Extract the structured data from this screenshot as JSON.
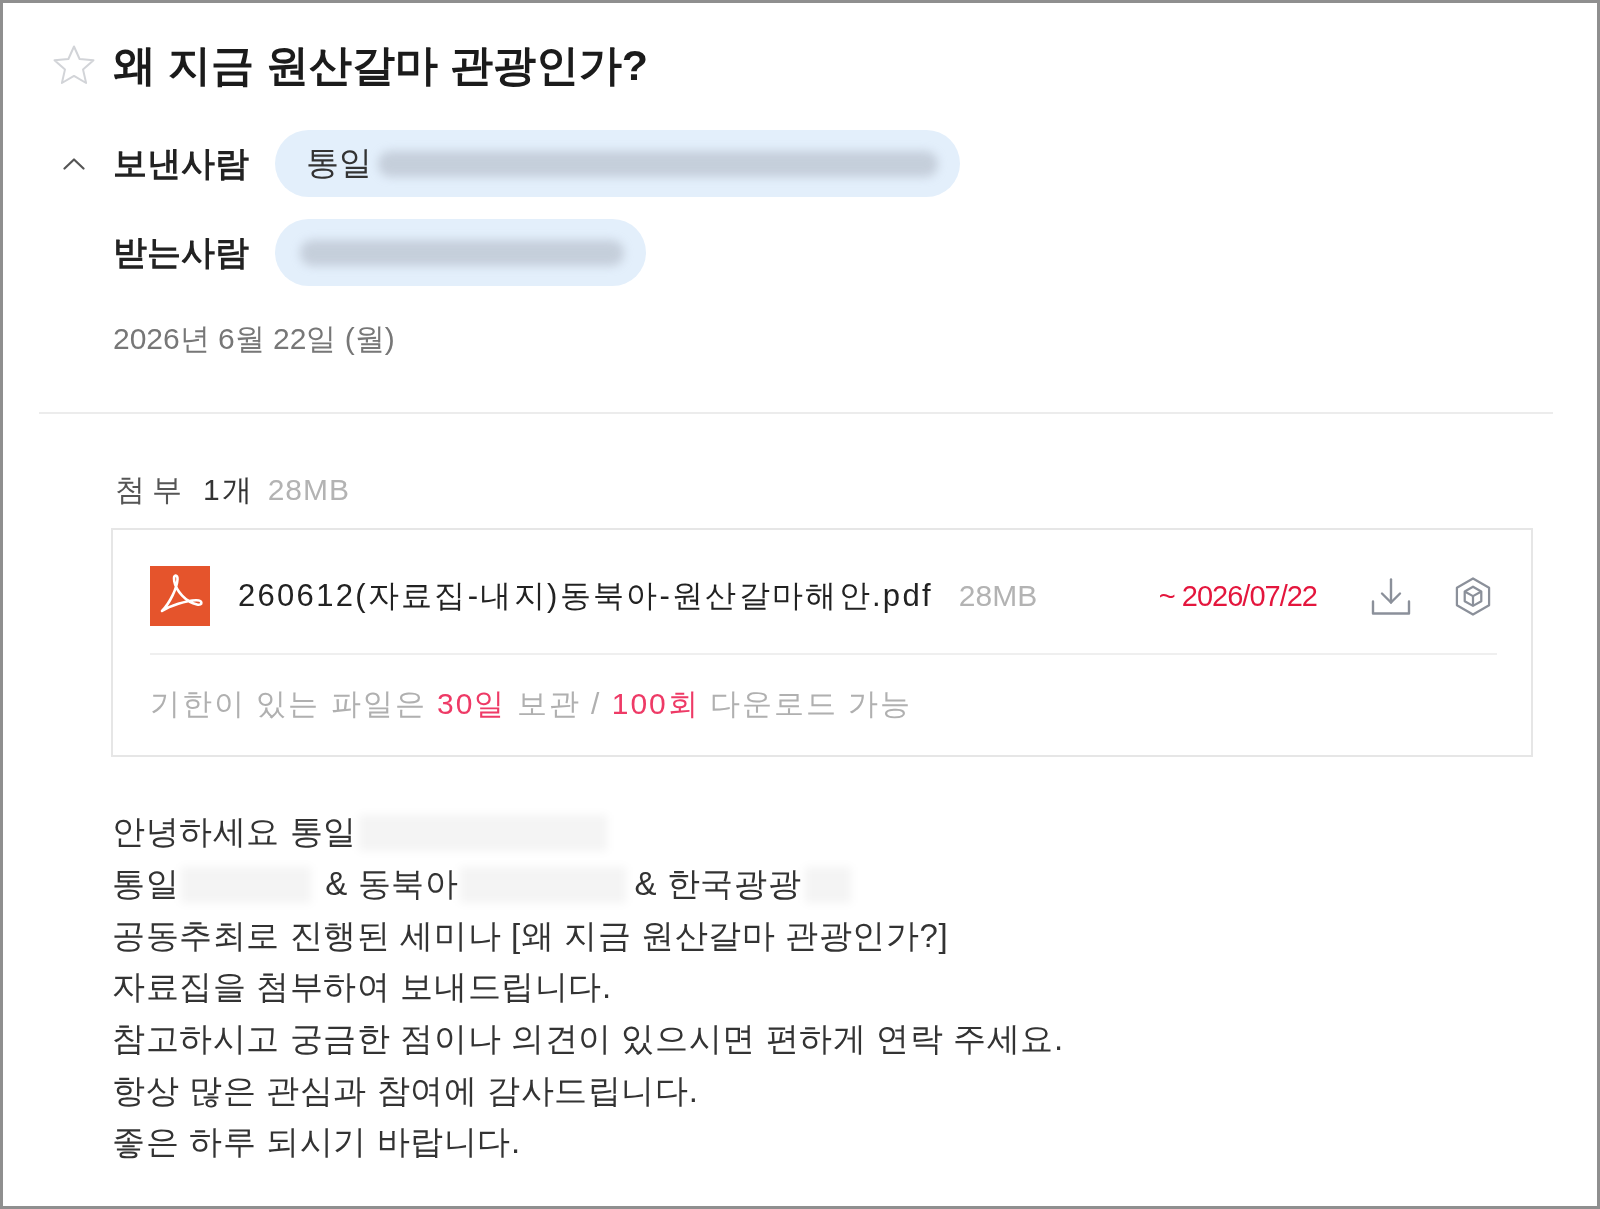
{
  "message": {
    "starred": false,
    "subject": "왜 지금 원산갈마 관광인가?",
    "details_expanded": true,
    "sender": {
      "label": "보낸사람",
      "parts": [
        {
          "kind": "text",
          "text": "통일"
        },
        {
          "kind": "redacted"
        }
      ]
    },
    "recipient": {
      "label": "받는사람",
      "parts": [
        {
          "kind": "redacted"
        }
      ]
    },
    "date": "2026년 6월 22일 (월)"
  },
  "attachments": {
    "label": "첨부",
    "count": "1개",
    "total_size": "28MB",
    "files": [
      {
        "name": "260612(자료집-내지)동북아-원산갈마해안.pdf",
        "size": "28MB",
        "expiry": "~ 2026/07/22"
      }
    ],
    "notice": [
      {
        "text": "기한이 있는 파일은 ",
        "highlight": false
      },
      {
        "text": "30일",
        "highlight": true
      },
      {
        "text": " 보관 / ",
        "highlight": false
      },
      {
        "text": "100회",
        "highlight": true
      },
      {
        "text": " 다운로드 가능",
        "highlight": false
      }
    ]
  },
  "body": [
    {
      "parts": [
        {
          "kind": "text",
          "text": "안녕하세요 통일"
        },
        {
          "kind": "redacted"
        }
      ]
    },
    {
      "parts": [
        {
          "kind": "text",
          "text": "통일"
        },
        {
          "kind": "redacted"
        },
        {
          "kind": "text",
          "text": "& 동북아"
        },
        {
          "kind": "redacted"
        },
        {
          "kind": "text",
          "text": "& 한국광광"
        },
        {
          "kind": "redacted"
        }
      ]
    },
    {
      "parts": [
        {
          "kind": "text",
          "text": "공동추최로 진행된 세미나 [왜 지금 원산갈마 관광인가?]"
        }
      ]
    },
    {
      "parts": [
        {
          "kind": "text",
          "text": "자료집을 첨부하여 보내드립니다."
        }
      ]
    },
    {
      "parts": [
        {
          "kind": "text",
          "text": "참고하시고 궁금한 점이나 의견이 있으시면 편하게 연락 주세요."
        }
      ]
    },
    {
      "parts": [
        {
          "kind": "text",
          "text": "항상 많은 관심과 참여에 감사드립니다."
        }
      ]
    },
    {
      "parts": [
        {
          "kind": "text",
          "text": "좋은 하루 되시기 바랍니다."
        }
      ]
    }
  ]
}
